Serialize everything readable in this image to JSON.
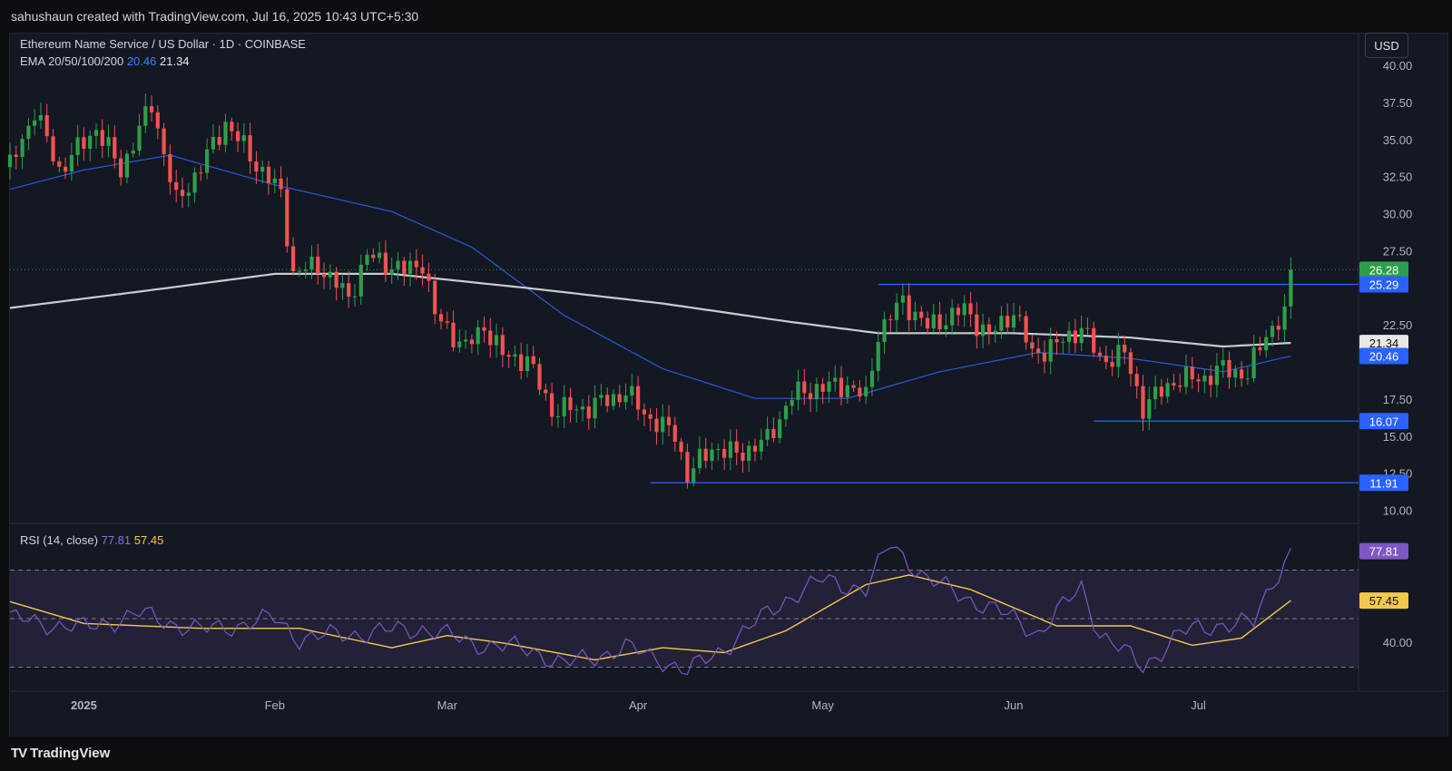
{
  "header": {
    "attribution": "sahushaun created with TradingView.com, Jul 16, 2025 10:43 UTC+5:30"
  },
  "legend": {
    "symbol": "Ethereum Name Service / US Dollar · 1D · COINBASE",
    "ema_label": "EMA 20/50/100/200",
    "ema_value_1": "20.46",
    "ema_value_2": "21.34",
    "rsi_label": "RSI (14, close)",
    "rsi_value": "77.81",
    "rsi_ma_value": "57.45"
  },
  "toolbar": {
    "currency": "USD"
  },
  "footer": {
    "brand": "TradingView",
    "logo": "TV"
  },
  "colors": {
    "up": "#26a69a",
    "up_body": "#2e9e4a",
    "down": "#ef5350",
    "ema_blue": "#2a5bd7",
    "ema_white": "#c9cbcf",
    "rsi": "#7e57c2",
    "rsi_ma": "#f2c94c",
    "level": "#2962ff"
  },
  "chart_data": [
    {
      "type": "candlestick",
      "title": "Ethereum Name Service / US Dollar · 1D · COINBASE",
      "ylim": [
        10,
        40
      ],
      "y_ticks": [
        "40.00",
        "37.50",
        "35.00",
        "32.50",
        "30.00",
        "27.50",
        "22.50",
        "17.50",
        "15.00",
        "12.50",
        "10.00"
      ],
      "x_ticks": [
        "2025",
        "Feb",
        "Mar",
        "Apr",
        "May",
        "Jun",
        "Jul"
      ],
      "x_range": [
        "2024-12-20",
        "2025-07-27"
      ],
      "ohlc_anchors": [
        {
          "date": "2024-12-20",
          "close": 33.2
        },
        {
          "date": "2024-12-24",
          "close": 37.0
        },
        {
          "date": "2024-12-28",
          "close": 33.0
        },
        {
          "date": "2025-01-03",
          "close": 35.8
        },
        {
          "date": "2025-01-07",
          "close": 33.0
        },
        {
          "date": "2025-01-12",
          "close": 37.5
        },
        {
          "date": "2025-01-16",
          "close": 30.8
        },
        {
          "date": "2025-01-20",
          "close": 33.2
        },
        {
          "date": "2025-01-24",
          "close": 36.2
        },
        {
          "date": "2025-01-29",
          "close": 33.4
        },
        {
          "date": "2025-02-02",
          "close": 31.4
        },
        {
          "date": "2025-02-04",
          "close": 26.0
        },
        {
          "date": "2025-02-08",
          "close": 26.6
        },
        {
          "date": "2025-02-13",
          "close": 24.4
        },
        {
          "date": "2025-02-16",
          "close": 27.2
        },
        {
          "date": "2025-02-22",
          "close": 26.2
        },
        {
          "date": "2025-02-25",
          "close": 26.8
        },
        {
          "date": "2025-02-27",
          "close": 23.2
        },
        {
          "date": "2025-03-04",
          "close": 21.0
        },
        {
          "date": "2025-03-07",
          "close": 22.5
        },
        {
          "date": "2025-03-10",
          "close": 20.5
        },
        {
          "date": "2025-03-14",
          "close": 20.2
        },
        {
          "date": "2025-03-18",
          "close": 16.8
        },
        {
          "date": "2025-03-24",
          "close": 17.0
        },
        {
          "date": "2025-03-30",
          "close": 18.0
        },
        {
          "date": "2025-04-03",
          "close": 16.2
        },
        {
          "date": "2025-04-07",
          "close": 15.2
        },
        {
          "date": "2025-04-09",
          "close": 12.4
        },
        {
          "date": "2025-04-13",
          "close": 14.3
        },
        {
          "date": "2025-04-17",
          "close": 13.8
        },
        {
          "date": "2025-04-22",
          "close": 14.8
        },
        {
          "date": "2025-04-26",
          "close": 17.8
        },
        {
          "date": "2025-04-30",
          "close": 18.3
        },
        {
          "date": "2025-05-05",
          "close": 18.5
        },
        {
          "date": "2025-05-08",
          "close": 17.6
        },
        {
          "date": "2025-05-10",
          "close": 22.0
        },
        {
          "date": "2025-05-14",
          "close": 24.2
        },
        {
          "date": "2025-05-18",
          "close": 22.4
        },
        {
          "date": "2025-05-24",
          "close": 23.6
        },
        {
          "date": "2025-05-28",
          "close": 21.8
        },
        {
          "date": "2025-06-01",
          "close": 23.5
        },
        {
          "date": "2025-06-04",
          "close": 20.6
        },
        {
          "date": "2025-06-08",
          "close": 21.2
        },
        {
          "date": "2025-06-12",
          "close": 22.4
        },
        {
          "date": "2025-06-15",
          "close": 20.2
        },
        {
          "date": "2025-06-19",
          "close": 20.6
        },
        {
          "date": "2025-06-22",
          "close": 17.0
        },
        {
          "date": "2025-06-27",
          "close": 18.8
        },
        {
          "date": "2025-07-02",
          "close": 19.0
        },
        {
          "date": "2025-07-05",
          "close": 19.6
        },
        {
          "date": "2025-07-09",
          "close": 19.2
        },
        {
          "date": "2025-07-12",
          "close": 22.0
        },
        {
          "date": "2025-07-15",
          "close": 23.2
        },
        {
          "date": "2025-07-16",
          "close": 26.28
        }
      ],
      "series": [
        {
          "name": "EMA",
          "value_label": "20.46",
          "values": [
            {
              "date": "2024-12-20",
              "value": 31.7
            },
            {
              "date": "2025-01-01",
              "value": 33.0
            },
            {
              "date": "2025-01-15",
              "value": 34.0
            },
            {
              "date": "2025-02-01",
              "value": 32.0
            },
            {
              "date": "2025-02-20",
              "value": 30.2
            },
            {
              "date": "2025-03-05",
              "value": 27.8
            },
            {
              "date": "2025-03-20",
              "value": 23.2
            },
            {
              "date": "2025-04-05",
              "value": 19.6
            },
            {
              "date": "2025-04-20",
              "value": 17.6
            },
            {
              "date": "2025-05-05",
              "value": 17.6
            },
            {
              "date": "2025-05-20",
              "value": 19.4
            },
            {
              "date": "2025-06-05",
              "value": 20.7
            },
            {
              "date": "2025-06-20",
              "value": 20.3
            },
            {
              "date": "2025-07-05",
              "value": 19.4
            },
            {
              "date": "2025-07-16",
              "value": 20.46
            }
          ]
        },
        {
          "name": "EMA",
          "value_label": "21.34",
          "values": [
            {
              "date": "2024-12-20",
              "value": 23.7
            },
            {
              "date": "2025-01-10",
              "value": 24.8
            },
            {
              "date": "2025-02-01",
              "value": 26.0
            },
            {
              "date": "2025-02-20",
              "value": 26.0
            },
            {
              "date": "2025-03-15",
              "value": 25.0
            },
            {
              "date": "2025-04-05",
              "value": 24.0
            },
            {
              "date": "2025-04-25",
              "value": 22.8
            },
            {
              "date": "2025-05-10",
              "value": 22.0
            },
            {
              "date": "2025-06-01",
              "value": 22.0
            },
            {
              "date": "2025-06-20",
              "value": 21.7
            },
            {
              "date": "2025-07-05",
              "value": 21.1
            },
            {
              "date": "2025-07-16",
              "value": 21.34
            }
          ]
        }
      ],
      "price_labels": [
        "26.28",
        "25.29",
        "21.34",
        "20.46",
        "16.07",
        "11.91"
      ],
      "horizontal_levels": [
        {
          "value": 25.29,
          "from": "2025-05-10",
          "to": "2025-07-27",
          "label": "25.29"
        },
        {
          "value": 16.07,
          "from": "2025-06-14",
          "to": "2025-07-27",
          "label": "16.07"
        },
        {
          "value": 11.91,
          "from": "2025-04-03",
          "to": "2025-07-27",
          "label": "11.91"
        }
      ],
      "last_price": 26.28
    },
    {
      "type": "line",
      "title": "RSI (14, close)",
      "ylim": [
        20,
        90
      ],
      "y_ticks": [
        "40.00"
      ],
      "bands": [
        30,
        50,
        70
      ],
      "series": [
        {
          "name": "RSI",
          "value_label": "77.81",
          "values": [
            {
              "date": "2024-12-20",
              "value": 50
            },
            {
              "date": "2025-01-01",
              "value": 46
            },
            {
              "date": "2025-01-10",
              "value": 52
            },
            {
              "date": "2025-01-20",
              "value": 45
            },
            {
              "date": "2025-02-01",
              "value": 50
            },
            {
              "date": "2025-02-05",
              "value": 42
            },
            {
              "date": "2025-02-15",
              "value": 44
            },
            {
              "date": "2025-02-25",
              "value": 46
            },
            {
              "date": "2025-03-05",
              "value": 40
            },
            {
              "date": "2025-03-15",
              "value": 37
            },
            {
              "date": "2025-03-20",
              "value": 31
            },
            {
              "date": "2025-03-30",
              "value": 38
            },
            {
              "date": "2025-04-05",
              "value": 33
            },
            {
              "date": "2025-04-09",
              "value": 28
            },
            {
              "date": "2025-04-15",
              "value": 38
            },
            {
              "date": "2025-04-25",
              "value": 58
            },
            {
              "date": "2025-05-01",
              "value": 66
            },
            {
              "date": "2025-05-08",
              "value": 62
            },
            {
              "date": "2025-05-12",
              "value": 81
            },
            {
              "date": "2025-05-18",
              "value": 66
            },
            {
              "date": "2025-05-25",
              "value": 58
            },
            {
              "date": "2025-06-01",
              "value": 50
            },
            {
              "date": "2025-06-05",
              "value": 44
            },
            {
              "date": "2025-06-12",
              "value": 63
            },
            {
              "date": "2025-06-15",
              "value": 44
            },
            {
              "date": "2025-06-22",
              "value": 30
            },
            {
              "date": "2025-06-28",
              "value": 44
            },
            {
              "date": "2025-07-05",
              "value": 48
            },
            {
              "date": "2025-07-10",
              "value": 48
            },
            {
              "date": "2025-07-13",
              "value": 65
            },
            {
              "date": "2025-07-16",
              "value": 77.81
            }
          ]
        },
        {
          "name": "RSI MA",
          "value_label": "57.45",
          "values": [
            {
              "date": "2024-12-20",
              "value": 57
            },
            {
              "date": "2025-01-01",
              "value": 48
            },
            {
              "date": "2025-01-20",
              "value": 46
            },
            {
              "date": "2025-02-05",
              "value": 46
            },
            {
              "date": "2025-02-20",
              "value": 38
            },
            {
              "date": "2025-03-01",
              "value": 43
            },
            {
              "date": "2025-03-10",
              "value": 40
            },
            {
              "date": "2025-03-25",
              "value": 33
            },
            {
              "date": "2025-04-05",
              "value": 38
            },
            {
              "date": "2025-04-15",
              "value": 36
            },
            {
              "date": "2025-04-25",
              "value": 45
            },
            {
              "date": "2025-05-08",
              "value": 64
            },
            {
              "date": "2025-05-15",
              "value": 68
            },
            {
              "date": "2025-05-25",
              "value": 62
            },
            {
              "date": "2025-06-08",
              "value": 47
            },
            {
              "date": "2025-06-20",
              "value": 47
            },
            {
              "date": "2025-06-30",
              "value": 39
            },
            {
              "date": "2025-07-08",
              "value": 42
            },
            {
              "date": "2025-07-16",
              "value": 57.45
            }
          ]
        }
      ]
    }
  ]
}
